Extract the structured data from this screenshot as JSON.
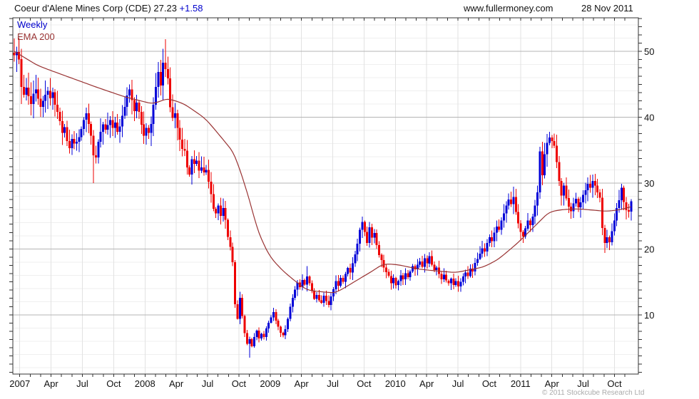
{
  "header": {
    "title_main": "Coeur d'Alene Mines Corp (CDE) 27.23",
    "title_change": "+1.58",
    "site": "www.fullermoney.com",
    "date": "28 Nov 2011"
  },
  "legend": {
    "timeframe": "Weekly",
    "overlay": "EMA 200"
  },
  "credit": "© 2011 Stockcube Research Ltd",
  "chart_data": {
    "type": "candlestick",
    "title": "Coeur d'Alene Mines Corp (CDE)",
    "timeframe": "Weekly",
    "overlay": "EMA 200",
    "last_close": 27.23,
    "change": 1.58,
    "prev_close": 25.65,
    "ylim": [
      1.0,
      55.1
    ],
    "y_major_ticks": [
      10,
      20,
      30,
      40,
      50
    ],
    "y_minor_gridline_step": 2,
    "y_tick_step": 1.25,
    "x_ticklabels": [
      "2007",
      "Apr",
      "Jul",
      "Oct",
      "2008",
      "Apr",
      "Jul",
      "Oct",
      "2009",
      "Apr",
      "Jul",
      "Oct",
      "2010",
      "Apr",
      "Jul",
      "Oct",
      "2011",
      "Apr",
      "Jul",
      "Oct"
    ],
    "weeks_per_quarter": 13.04,
    "first_tick_week": 2.3,
    "first_open": 49.8,
    "closes": [
      49.4,
      49.9,
      48.8,
      44.6,
      43.4,
      44.5,
      43.2,
      42.0,
      43.6,
      44.2,
      42.8,
      41.6,
      42.5,
      43.4,
      44.0,
      42.9,
      43.8,
      41.9,
      40.8,
      39.4,
      37.6,
      38.5,
      36.4,
      35.3,
      36.7,
      36.0,
      36.3,
      37.0,
      38.2,
      39.6,
      40.6,
      39.0,
      37.2,
      34.2,
      33.9,
      36.3,
      37.8,
      38.9,
      38.1,
      38.8,
      39.6,
      38.4,
      39.2,
      37.8,
      38.6,
      40.2,
      41.6,
      43.3,
      44.2,
      42.6,
      40.9,
      42.2,
      40.8,
      38.9,
      37.2,
      38.4,
      37.6,
      39.0,
      41.9,
      44.6,
      46.9,
      44.8,
      48.3,
      47.3,
      45.9,
      41.5,
      39.9,
      40.6,
      38.4,
      36.6,
      35.2,
      34.9,
      32.4,
      31.3,
      33.6,
      32.9,
      33.4,
      31.9,
      32.4,
      31.6,
      32.0,
      30.2,
      28.3,
      26.1,
      25.4,
      26.6,
      25.0,
      26.2,
      24.4,
      21.8,
      20.3,
      18.0,
      11.6,
      9.4,
      12.6,
      9.8,
      7.2,
      5.6,
      6.3,
      5.2,
      6.6,
      7.6,
      6.4,
      7.1,
      6.6,
      7.9,
      8.8,
      9.6,
      10.4,
      9.1,
      8.2,
      7.3,
      6.9,
      7.8,
      9.4,
      11.2,
      12.6,
      13.8,
      14.9,
      14.2,
      15.3,
      14.6,
      15.8,
      14.8,
      13.6,
      12.4,
      13.0,
      12.2,
      11.8,
      12.9,
      12.1,
      11.5,
      12.8,
      13.9,
      15.1,
      14.4,
      15.6,
      15.0,
      16.2,
      17.1,
      16.4,
      17.8,
      19.2,
      20.8,
      22.9,
      24.1,
      22.6,
      20.9,
      23.3,
      21.7,
      22.4,
      20.6,
      19.1,
      18.3,
      17.2,
      16.5,
      15.9,
      14.8,
      15.6,
      14.5,
      15.1,
      16.0,
      15.4,
      16.3,
      15.7,
      16.6,
      17.4,
      16.9,
      17.6,
      18.1,
      17.3,
      18.6,
      17.8,
      18.9,
      17.6,
      16.8,
      17.2,
      16.2,
      15.4,
      16.1,
      15.2,
      14.8,
      15.5,
      14.5,
      15.1,
      14.3,
      15.0,
      15.8,
      16.4,
      15.9,
      17.0,
      16.6,
      17.9,
      18.5,
      19.3,
      20.1,
      19.6,
      20.9,
      21.8,
      21.2,
      22.5,
      23.4,
      22.9,
      24.3,
      25.4,
      26.6,
      27.5,
      26.8,
      27.9,
      25.6,
      23.9,
      22.6,
      21.9,
      23.1,
      24.3,
      23.6,
      24.9,
      26.6,
      28.6,
      34.8,
      31.2,
      34.4,
      36.1,
      36.9,
      36.4,
      35.7,
      33.2,
      30.3,
      28.1,
      29.6,
      27.7,
      26.4,
      25.7,
      26.9,
      27.6,
      26.3,
      27.1,
      28.2,
      28.9,
      29.9,
      29.3,
      30.3,
      29.6,
      28.6,
      27.8,
      23.2,
      20.9,
      21.8,
      21.0,
      22.7,
      24.3,
      26.2,
      27.4,
      29.3,
      27.1,
      25.9,
      25.65,
      27.23
    ],
    "wick_overrides": {
      "1": {
        "h": 50.7
      },
      "3": {
        "l": 42.0
      },
      "33": {
        "l": 30.0
      },
      "62": {
        "h": 50.4
      },
      "63": {
        "h": 51.85
      },
      "64": {
        "h": 49.2
      },
      "98": {
        "l": 3.5
      },
      "122": {
        "h": 17.4
      },
      "145": {
        "h": 24.9
      },
      "173": {
        "h": 19.5
      },
      "183": {
        "l": 13.9
      },
      "212": {
        "l": 20.9
      },
      "223": {
        "h": 37.8
      },
      "232": {
        "l": 24.6
      },
      "241": {
        "h": 31.3
      },
      "246": {
        "l": 19.4
      },
      "248": {
        "l": 19.8
      },
      "253": {
        "h": 29.9
      }
    },
    "ema_anchors": [
      [
        0,
        50.0
      ],
      [
        10,
        47.8
      ],
      [
        22,
        46.2
      ],
      [
        34,
        44.6
      ],
      [
        46,
        43.1
      ],
      [
        58,
        42.0
      ],
      [
        64,
        42.9
      ],
      [
        71,
        42.0
      ],
      [
        80,
        39.7
      ],
      [
        92,
        34.4
      ],
      [
        98,
        27.5
      ],
      [
        102,
        22.0
      ],
      [
        107,
        18.5
      ],
      [
        113,
        16.3
      ],
      [
        122,
        13.7
      ],
      [
        134,
        13.3
      ],
      [
        143,
        15.3
      ],
      [
        149,
        16.6
      ],
      [
        154,
        17.8
      ],
      [
        160,
        17.6
      ],
      [
        169,
        16.9
      ],
      [
        184,
        16.4
      ],
      [
        196,
        17.3
      ],
      [
        202,
        18.5
      ],
      [
        210,
        21.0
      ],
      [
        217,
        23.5
      ],
      [
        223,
        25.7
      ],
      [
        229,
        26.0
      ],
      [
        235,
        26.1
      ],
      [
        247,
        25.7
      ],
      [
        253,
        26.0
      ],
      [
        257,
        26.4
      ]
    ],
    "colors": {
      "up": "#0000d8",
      "down": "#ee0000",
      "ema": "#993333",
      "legend_weekly": "#0000cc",
      "title_change": "#0000cc"
    },
    "legend_position": "top-left",
    "grid": true
  }
}
